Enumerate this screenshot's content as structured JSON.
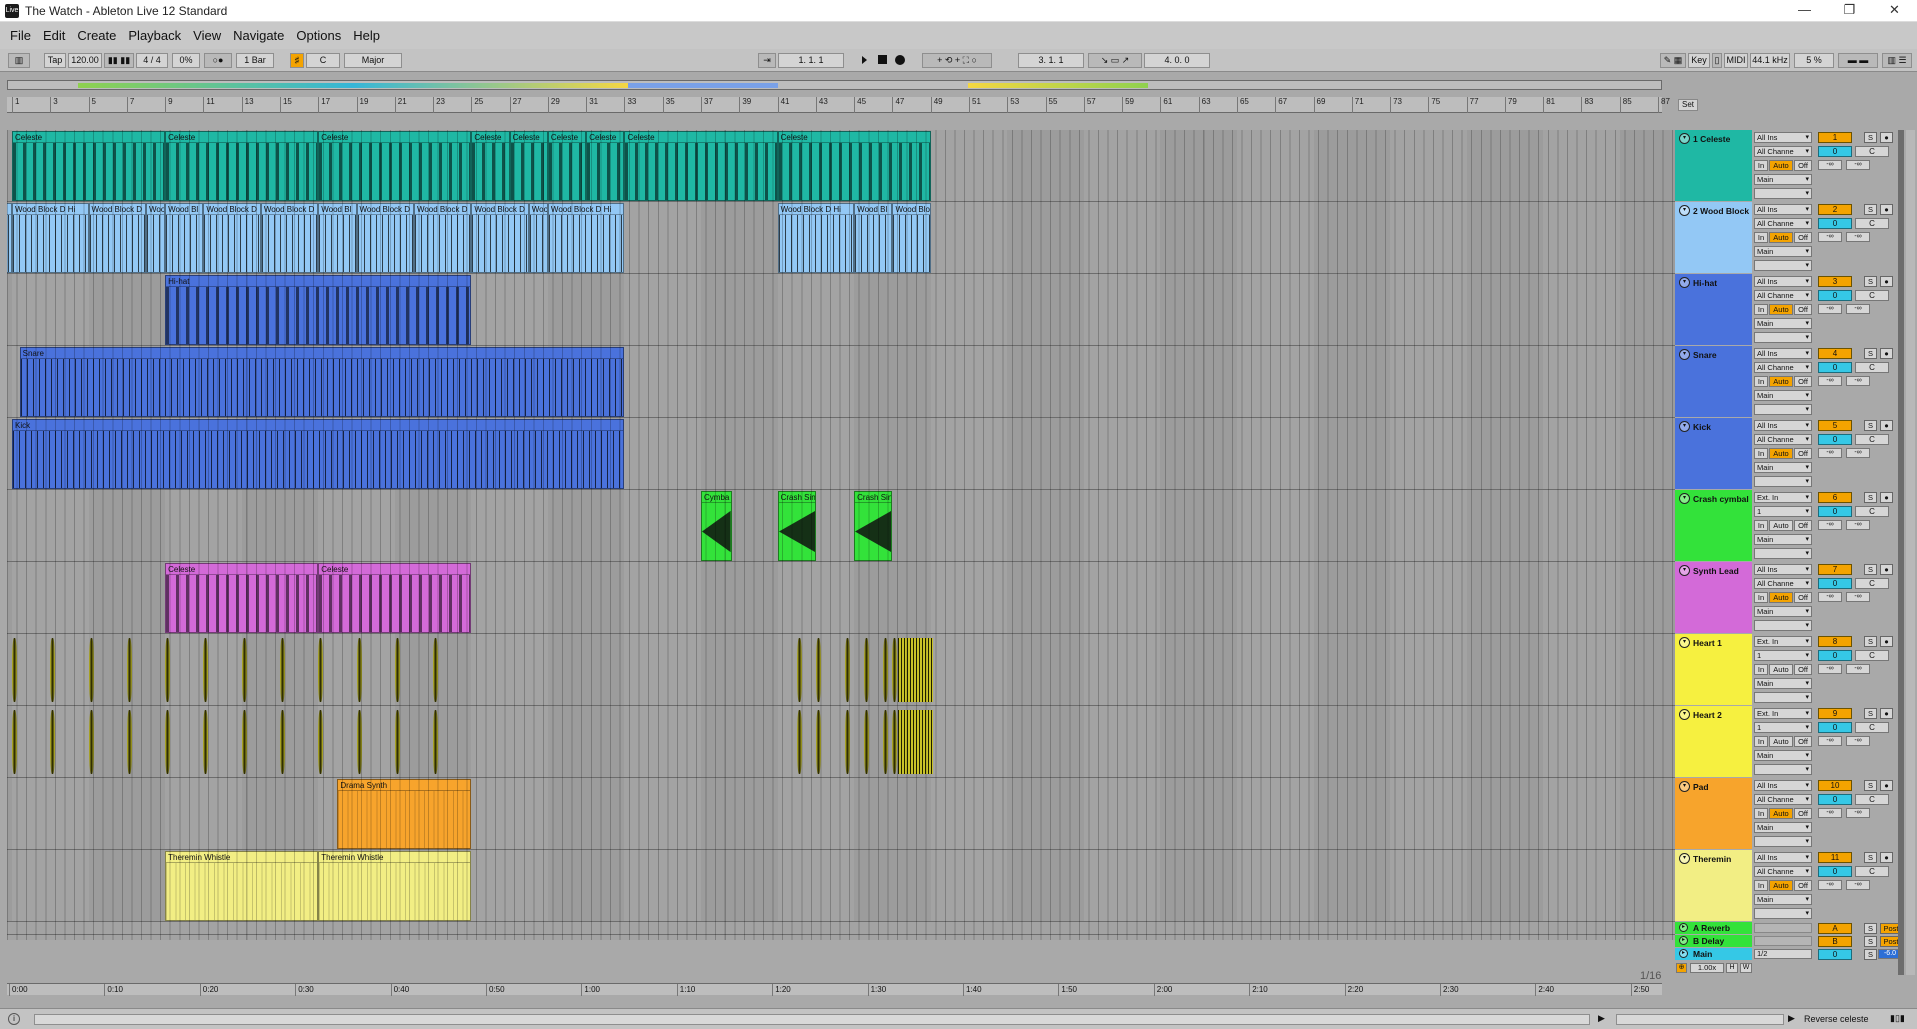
{
  "window": {
    "title": "The Watch - Ableton Live 12 Standard",
    "app_icon": "Live"
  },
  "menu": [
    "File",
    "Edit",
    "Create",
    "Playback",
    "View",
    "Navigate",
    "Options",
    "Help"
  ],
  "control_bar": {
    "tap": "Tap",
    "tempo": "120.00",
    "time_signature": "4 / 4",
    "groove": "0%",
    "quantization": "1 Bar",
    "scale_root": "C",
    "scale_name": "Major",
    "song_position": "1.   1.   1",
    "loop_start": "3.   1.   1",
    "loop_length": "4.   0.   0",
    "key_label": "Key",
    "midi_label": "MIDI",
    "sample_rate": "44.1 kHz",
    "cpu": "5 %"
  },
  "ruler": {
    "bars": [
      "1",
      "3",
      "5",
      "7",
      "9",
      "11",
      "13",
      "15",
      "17",
      "19",
      "21",
      "23",
      "25",
      "27",
      "29",
      "31",
      "33",
      "35",
      "37",
      "39",
      "41",
      "43",
      "45",
      "47",
      "49",
      "51",
      "53",
      "55",
      "57",
      "59",
      "61",
      "63",
      "65",
      "67",
      "69",
      "71",
      "73",
      "75",
      "77",
      "79",
      "81",
      "83",
      "85",
      "87"
    ],
    "set_label": "Set"
  },
  "time_ruler": [
    "0:00",
    "0:10",
    "0:20",
    "0:30",
    "0:40",
    "0:50",
    "1:00",
    "1:10",
    "1:20",
    "1:30",
    "1:40",
    "1:50",
    "2:00",
    "2:10",
    "2:20",
    "2:30",
    "2:40",
    "2:50"
  ],
  "grid_label": "1/16",
  "tracks": [
    {
      "name": "1 Celeste",
      "color": "#1fb8a4",
      "input": "All Ins",
      "channel": "All Channe",
      "out": "Main",
      "num": "1",
      "vol": "0",
      "pan": "C",
      "auto": true,
      "clips": [
        {
          "name": "Celeste",
          "start": 1,
          "end": 9
        },
        {
          "name": "Celeste",
          "start": 9,
          "end": 17
        },
        {
          "name": "Celeste",
          "start": 17,
          "end": 25
        },
        {
          "name": "Celeste",
          "start": 25,
          "end": 27
        },
        {
          "name": "Celeste",
          "start": 27,
          "end": 29
        },
        {
          "name": "Celeste",
          "start": 29,
          "end": 31
        },
        {
          "name": "Celeste",
          "start": 31,
          "end": 33
        },
        {
          "name": "Celeste",
          "start": 33,
          "end": 41
        },
        {
          "name": "Celeste",
          "start": 41,
          "end": 49
        }
      ]
    },
    {
      "name": "2 Wood Block",
      "color": "#93c8f5",
      "input": "All Ins",
      "channel": "All Channe",
      "out": "Main",
      "num": "2",
      "vol": "0",
      "pan": "C",
      "auto": true,
      "clips": [
        {
          "name": "Wood Block D Hi",
          "start": -3,
          "end": 1
        },
        {
          "name": "Wood Block D Hi",
          "start": 1,
          "end": 5
        },
        {
          "name": "Wood Block D",
          "start": 5,
          "end": 8
        },
        {
          "name": "Wood",
          "start": 8,
          "end": 9
        },
        {
          "name": "Wood Bl",
          "start": 9,
          "end": 11
        },
        {
          "name": "Wood Block D",
          "start": 11,
          "end": 14
        },
        {
          "name": "Wood Block D",
          "start": 14,
          "end": 17
        },
        {
          "name": "Wood Bl",
          "start": 17,
          "end": 19
        },
        {
          "name": "Wood Block D",
          "start": 19,
          "end": 22
        },
        {
          "name": "Wood Block D",
          "start": 22,
          "end": 25
        },
        {
          "name": "Wood Block D",
          "start": 25,
          "end": 28
        },
        {
          "name": "Wood Bl",
          "start": 28,
          "end": 29
        },
        {
          "name": "Wood Block D Hi",
          "start": 29,
          "end": 33
        },
        {
          "name": "Wood Block D Hi",
          "start": 41,
          "end": 45
        },
        {
          "name": "Wood Bl",
          "start": 45,
          "end": 47
        },
        {
          "name": "Wood Bloc",
          "start": 47,
          "end": 49
        }
      ]
    },
    {
      "name": "Hi-hat",
      "color": "#4a72dc",
      "input": "All Ins",
      "channel": "All Channe",
      "out": "Main",
      "num": "3",
      "vol": "0",
      "pan": "C",
      "auto": true,
      "clips": [
        {
          "name": "Hi-hat",
          "start": 9,
          "end": 25
        }
      ]
    },
    {
      "name": "Snare",
      "color": "#4a72dc",
      "input": "All Ins",
      "channel": "All Channe",
      "out": "Main",
      "num": "4",
      "vol": "0",
      "pan": "C",
      "auto": true,
      "clips": [
        {
          "name": "Snare",
          "start": 1.4,
          "end": 33
        }
      ]
    },
    {
      "name": "Kick",
      "color": "#4a72dc",
      "input": "All Ins",
      "channel": "All Channe",
      "out": "Main",
      "num": "5",
      "vol": "0",
      "pan": "C",
      "auto": true,
      "clips": [
        {
          "name": "Kick",
          "start": 1,
          "end": 33
        }
      ]
    },
    {
      "name": "Crash cymbal",
      "color": "#33e23a",
      "input": "Ext. In",
      "channel": "1",
      "out": "Main",
      "num": "6",
      "vol": "0",
      "pan": "C",
      "auto": false,
      "clips": [
        {
          "name": "Cymba",
          "start": -1,
          "end": 0.6
        },
        {
          "name": "Cymba",
          "start": 37,
          "end": 38.6
        },
        {
          "name": "Crash Sin",
          "start": 41,
          "end": 43
        },
        {
          "name": "Crash Sin",
          "start": 45,
          "end": 47
        }
      ]
    },
    {
      "name": "Synth Lead",
      "color": "#d36ad8",
      "input": "All Ins",
      "channel": "All Channe",
      "out": "Main",
      "num": "7",
      "vol": "0",
      "pan": "C",
      "auto": true,
      "clips": [
        {
          "name": "Celeste",
          "start": 9,
          "end": 17
        },
        {
          "name": "Celeste",
          "start": 17,
          "end": 25
        }
      ]
    },
    {
      "name": "Heart 1",
      "color": "#f6f040",
      "input": "Ext. In",
      "channel": "1",
      "out": "Main",
      "num": "8",
      "vol": "0",
      "pan": "C",
      "auto": false,
      "clips": []
    },
    {
      "name": "Heart 2",
      "color": "#f6f040",
      "input": "Ext. In",
      "channel": "1",
      "out": "Main",
      "num": "9",
      "vol": "0",
      "pan": "C",
      "auto": false,
      "clips": []
    },
    {
      "name": "Pad",
      "color": "#f7a42c",
      "input": "All Ins",
      "channel": "All Channe",
      "out": "Main",
      "num": "10",
      "vol": "0",
      "pan": "C",
      "auto": true,
      "clips": [
        {
          "name": "Drama Synth",
          "start": 18,
          "end": 25
        }
      ]
    },
    {
      "name": "Theremin",
      "color": "#f2ee84",
      "input": "All Ins",
      "channel": "All Channe",
      "out": "Main",
      "num": "11",
      "vol": "0",
      "pan": "C",
      "auto": true,
      "clips": [
        {
          "name": "Theremin Whistle",
          "start": 9,
          "end": 17
        },
        {
          "name": "Theremin Whistle",
          "start": 17,
          "end": 25
        }
      ]
    }
  ],
  "returns": [
    {
      "name": "A Reverb",
      "color": "#33e23a",
      "letter": "A",
      "post": "Post"
    },
    {
      "name": "B Delay",
      "color": "#33e23a",
      "letter": "B",
      "post": "Post"
    }
  ],
  "master": {
    "name": "Main",
    "color": "#35c8e6",
    "output": "1/2",
    "vol": "0",
    "peak": "-6.0",
    "zoom": "1.00x"
  },
  "mix_labels": {
    "solo": "S",
    "in": "In",
    "auto": "Auto",
    "off": "Off",
    "send": "-∞",
    "h": "H",
    "w": "W"
  },
  "status": {
    "device_name": "Reverse celeste"
  }
}
